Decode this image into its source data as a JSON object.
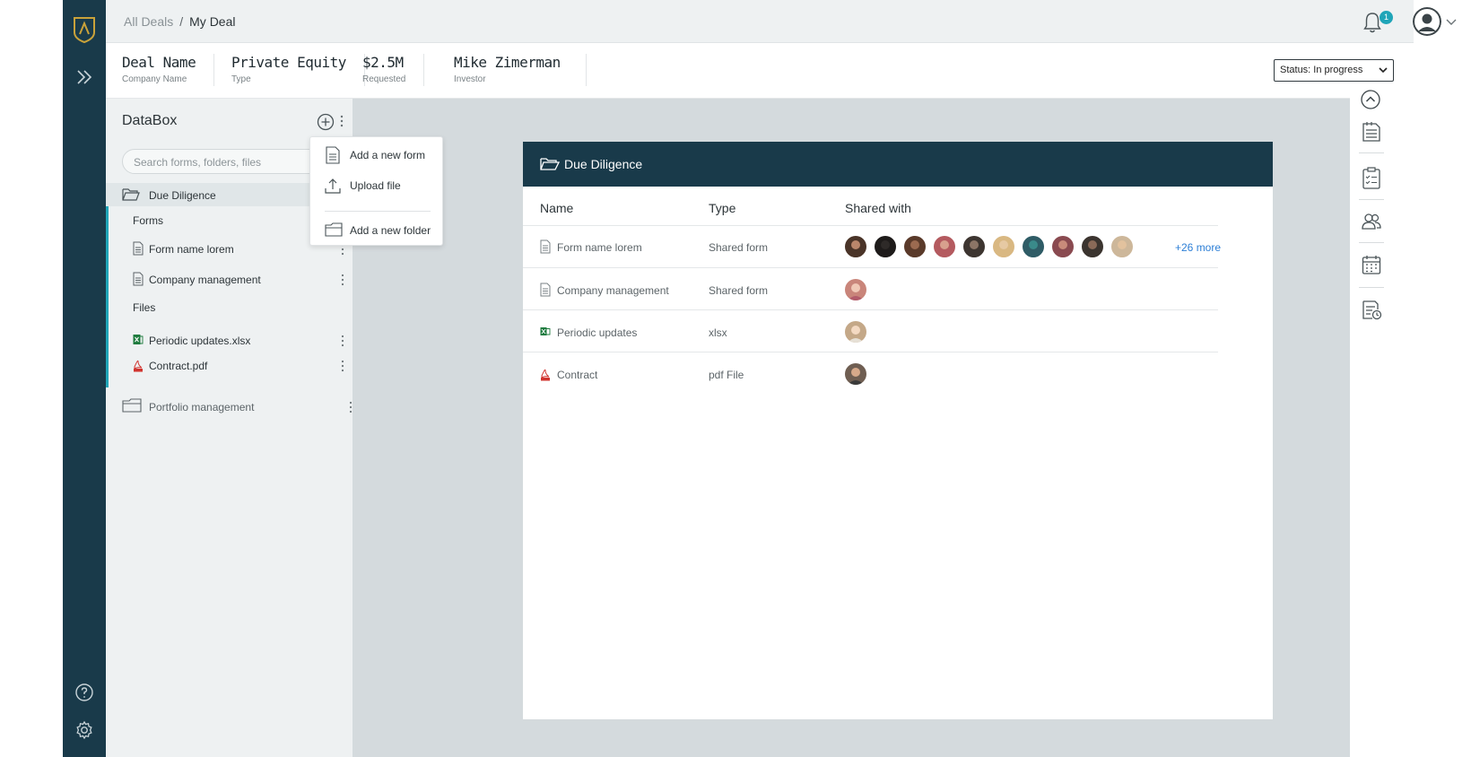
{
  "breadcrumb": {
    "root": "All Deals",
    "separator": "/",
    "current": "My Deal"
  },
  "notifications": {
    "count": "1"
  },
  "deal": {
    "fields": [
      {
        "value": "Deal Name",
        "label": "Company Name"
      },
      {
        "value": "Private Equity",
        "label": "Type"
      },
      {
        "value": "$2.5M",
        "label": "Requested"
      },
      {
        "value": "Mike Zimerman",
        "label": "Investor"
      }
    ],
    "status": "Status: In progress"
  },
  "databox": {
    "title": "DataBox",
    "search_placeholder": "Search forms, folders, files",
    "folder_due": "Due Diligence",
    "forms_heading": "Forms",
    "form1": "Form name lorem",
    "form2": "Company management",
    "files_heading": "Files",
    "file1": "Periodic updates.xlsx",
    "file2": "Contract.pdf",
    "folder_portfolio": "Portfolio management"
  },
  "menu": {
    "add_form": "Add a new form",
    "upload": "Upload file",
    "add_folder": "Add a new folder"
  },
  "panel": {
    "title": "Due Diligence",
    "columns": {
      "name": "Name",
      "type": "Type",
      "shared": "Shared with"
    },
    "rows": [
      {
        "name": "Form name lorem",
        "type": "Shared form"
      },
      {
        "name": "Company management",
        "type": "Shared form"
      },
      {
        "name": "Periodic updates",
        "type": "xlsx"
      },
      {
        "name": "Contract",
        "type": "pdf File"
      }
    ],
    "more": "+26 more"
  },
  "colors": {
    "navy": "#193a4a",
    "teal": "#1fa5b8",
    "link": "#2d7fd6",
    "excel": "#1e7b3e",
    "pdf": "#d1342f"
  }
}
